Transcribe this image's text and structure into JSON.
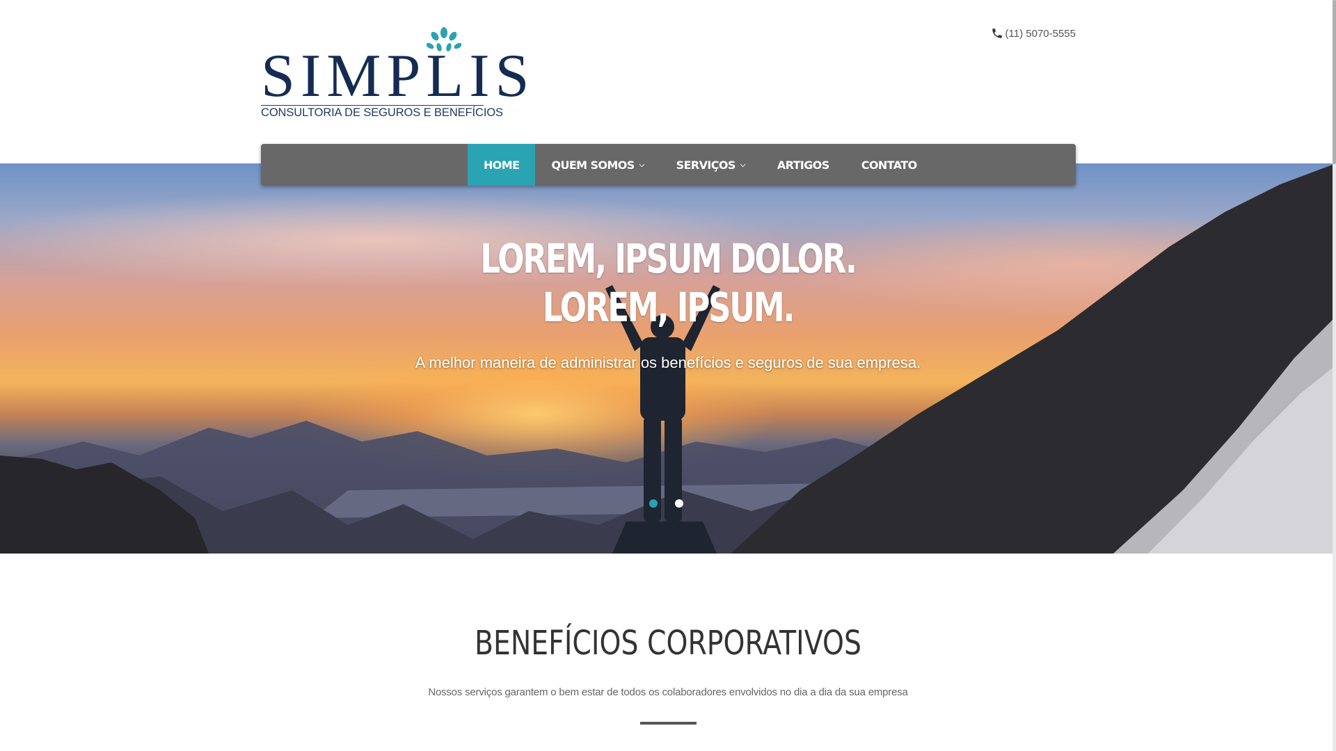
{
  "brand": {
    "name": "SIMPLIS",
    "tagline": "CONSULTORIA DE SEGUROS E BENEFÍCIOS",
    "primary_color": "#142c52",
    "accent_color": "#2aa3b3"
  },
  "header": {
    "phone": "(11) 5070-5555",
    "phone_icon": "phone-icon"
  },
  "nav": {
    "items": [
      {
        "label": "HOME",
        "active": true,
        "has_dropdown": false
      },
      {
        "label": "QUEM SOMOS",
        "active": false,
        "has_dropdown": true
      },
      {
        "label": "SERVIÇOS",
        "active": false,
        "has_dropdown": true
      },
      {
        "label": "ARTIGOS",
        "active": false,
        "has_dropdown": false
      },
      {
        "label": "CONTATO",
        "active": false,
        "has_dropdown": false
      }
    ],
    "dropdown_icon": "chevron-down-icon"
  },
  "hero": {
    "headline_line1": "LOREM, IPSUM DOLOR.",
    "headline_line2": "LOREM, IPSUM.",
    "subheadline": "A melhor maneira de administrar os benefícios e seguros de sua empresa.",
    "slides": 2,
    "active_slide": 1
  },
  "section": {
    "title": "BENEFÍCIOS CORPORATIVOS",
    "subtitle": "Nossos serviços garantem o bem estar de todos os colaboradores envolvidos no dia a dia da sua empresa"
  }
}
